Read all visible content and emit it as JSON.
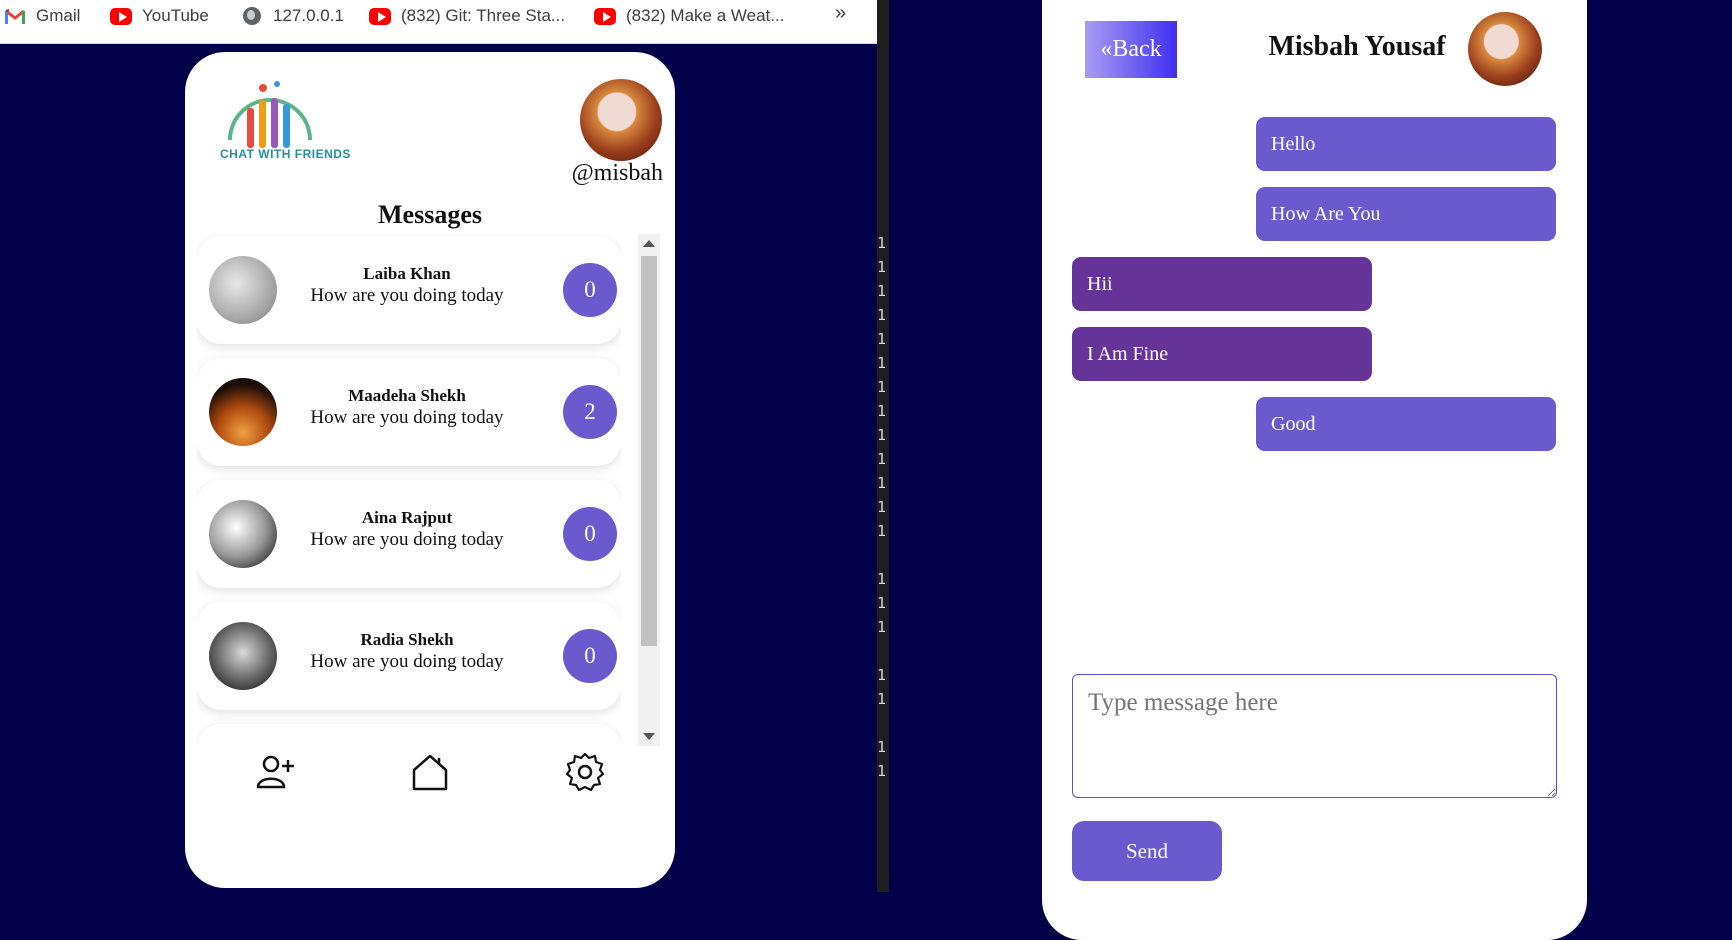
{
  "bookmarks": [
    {
      "label": "Gmail",
      "icon": "gmail-icon"
    },
    {
      "label": "YouTube",
      "icon": "youtube-icon"
    },
    {
      "label": "127.0.0.1",
      "icon": "globe-icon"
    },
    {
      "label": "(832) Git: Three Sta...",
      "icon": "youtube-icon"
    },
    {
      "label": "(832) Make a Weat...",
      "icon": "youtube-icon"
    }
  ],
  "bookmarks_more": "»",
  "editor": {
    "lines": [
      "1",
      "1",
      "1",
      "1",
      "1",
      "1",
      "1",
      "1",
      "1",
      "1",
      "1",
      "1",
      "1",
      "1",
      "1",
      "1",
      "1",
      "1",
      "1",
      "1"
    ]
  },
  "left_app": {
    "logo_text": "CHAT WITH FRIENDS",
    "username": "@misbah",
    "title": "Messages",
    "contacts": [
      {
        "name": "Laiba Khan",
        "message": "How are you doing today",
        "unread": "0"
      },
      {
        "name": "Maadeha Shekh",
        "message": "How are you doing today",
        "unread": "2"
      },
      {
        "name": "Aina Rajput",
        "message": "How are you doing today",
        "unread": "0"
      },
      {
        "name": "Radia Shekh",
        "message": "How are you doing today",
        "unread": "0"
      }
    ],
    "nav": [
      "add-user-icon",
      "home-icon",
      "settings-icon"
    ]
  },
  "right_app": {
    "back_label": "«Back",
    "chat_name": "Misbah Yousaf",
    "messages": [
      {
        "text": "Hello",
        "direction": "sent"
      },
      {
        "text": "How Are You",
        "direction": "sent"
      },
      {
        "text": "Hii",
        "direction": "received"
      },
      {
        "text": "I Am Fine",
        "direction": "received"
      },
      {
        "text": "Good",
        "direction": "sent"
      }
    ],
    "input_placeholder": "Type message here",
    "send_label": "Send"
  },
  "colors": {
    "background": "#03004a",
    "accent": "#6a5acd",
    "received_bubble": "#663399",
    "back_gradient_start": "#a99cf2",
    "back_gradient_end": "#3f2ff0"
  }
}
